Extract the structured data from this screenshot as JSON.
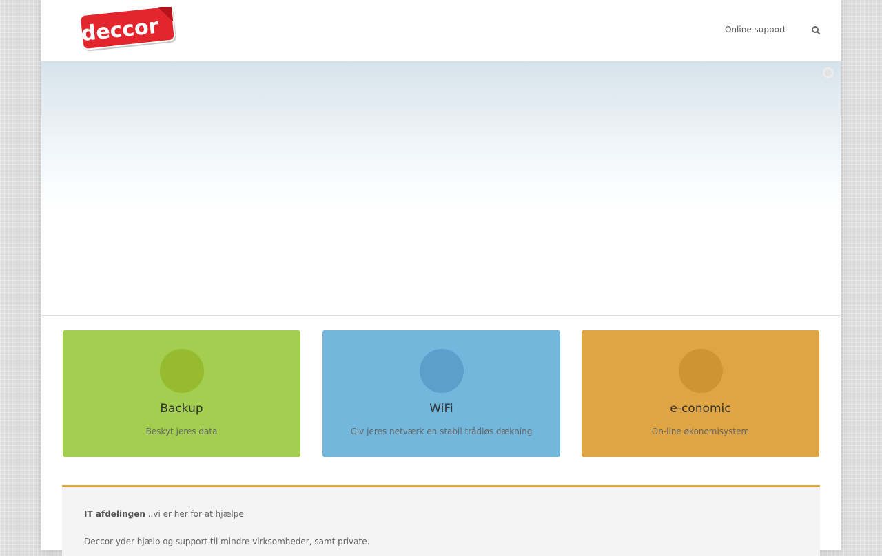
{
  "header": {
    "logo_text": "deccor",
    "nav_support": "Online support"
  },
  "cards": [
    {
      "title": "Backup",
      "subtitle": "Beskyt jeres data",
      "color": "#a2cf4f",
      "circle_color": "#97bb2f"
    },
    {
      "title": "WiFi",
      "subtitle": "Giv jeres netværk en stabil trådløs dækning",
      "color": "#73b8dc",
      "circle_color": "#5aa0cb"
    },
    {
      "title": "e-conomic",
      "subtitle": "On-line økonomisystem",
      "color": "#dfa544",
      "circle_color": "#cf9432"
    }
  ],
  "info": {
    "heading": "IT afdelingen",
    "tagline": " ..vi er her for at hjælpe",
    "body": "Deccor yder hjælp og support til mindre virksomheder, samt private."
  }
}
